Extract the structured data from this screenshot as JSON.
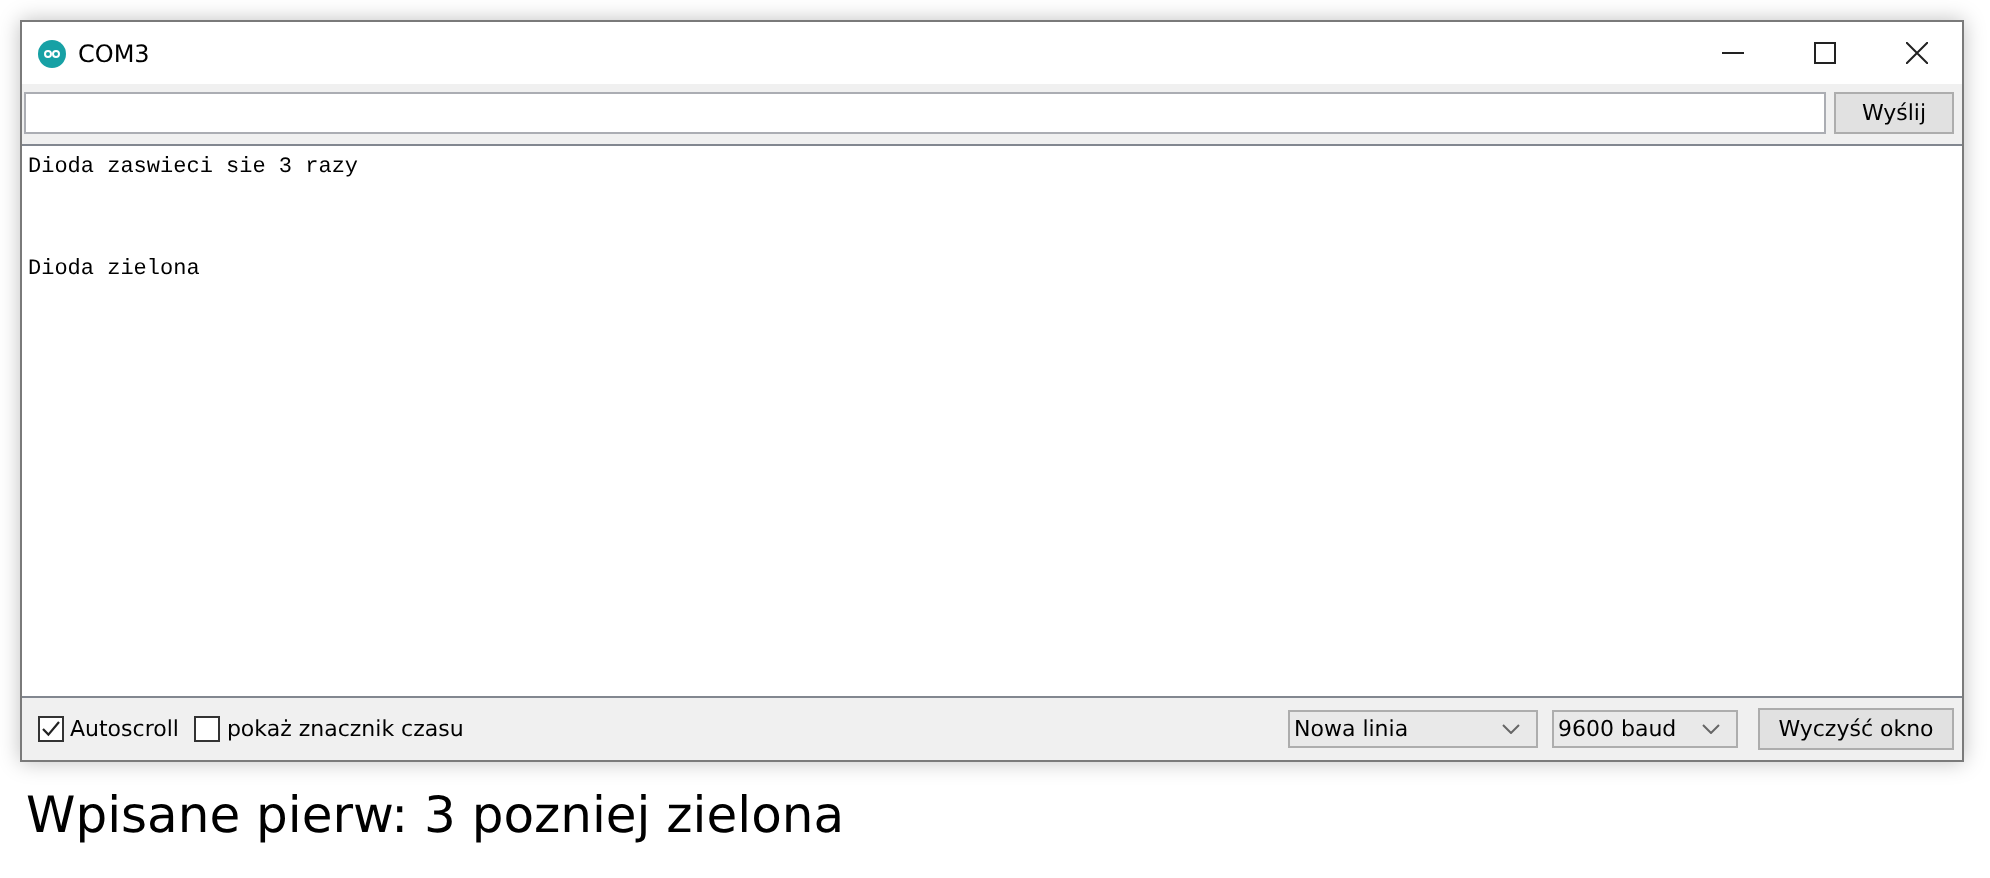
{
  "window": {
    "title": "COM3"
  },
  "send_button": "Wyślij",
  "output_lines": [
    "Dioda zaswieci sie 3 razy",
    "Dioda zielona"
  ],
  "options": [
    {
      "label": "Autoscroll",
      "checked": true
    },
    {
      "label": "pokaż znacznik czasu",
      "checked": false
    }
  ],
  "line_ending": "Nowa linia",
  "baud_rate": "9600 baud",
  "clear_button": "Wyczyść okno",
  "caption": "Wpisane pierw: 3 pozniej zielona"
}
